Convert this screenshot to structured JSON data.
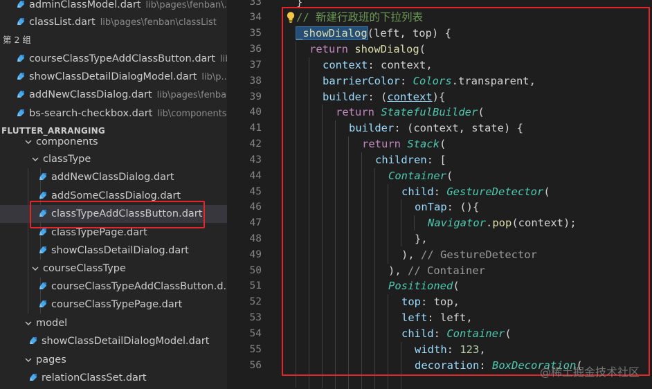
{
  "sidebar": {
    "top_items": [
      {
        "name": "adminClassModel.dart",
        "path": "lib\\pages\\fenban\\..."
      },
      {
        "name": "classList.dart",
        "path": "lib\\pages\\fenban\\classList"
      }
    ],
    "group_label": "第 2 组",
    "group_items": [
      {
        "name": "courseClassTypeAddClassButton.dart",
        "path": "lib..."
      },
      {
        "name": "showClassDetailDialogModel.dart",
        "path": "lib\\p..."
      },
      {
        "name": "addNewClassDialog.dart",
        "path": "lib\\pages\\fenba..."
      },
      {
        "name": "bs-search-checkbox.dart",
        "path": "lib\\components"
      }
    ],
    "project_title": "FLUTTER_ARRANGING",
    "tree": {
      "components": "components",
      "classType": "classType",
      "classType_files": [
        "addNewClassDialog.dart",
        "addSomeClassDialog.dart",
        "classTypeAddClassButton.dart",
        "classTypePage.dart",
        "showClassDetailDialog.dart"
      ],
      "courseClassType": "courseClassType",
      "courseClassType_files": [
        "courseClassTypeAddClassButton.d...",
        "courseClassTypePage.dart"
      ],
      "model": "model",
      "model_files": [
        "showClassDetailDialogModel.dart"
      ],
      "pages": "pages",
      "pages_files": [
        "relationClassSet.dart"
      ]
    }
  },
  "editor": {
    "line_numbers": [
      "33",
      "34",
      "35",
      "36",
      "37",
      "38",
      "39",
      "40",
      "41",
      "42",
      "43",
      "44",
      "45",
      "46",
      "47",
      "48",
      "49",
      "50",
      "51",
      "52",
      "53",
      "54",
      "55",
      "56"
    ],
    "code": {
      "l33": "}",
      "l34": "// 新建行政班的下拉列表",
      "l35_fn": "_showDialog",
      "l35_rest": "(left, top) {",
      "l36_kw": "return",
      "l36_fn": "showDialog",
      "l36_rest": "(",
      "l37_p": "context",
      "l37_rest": ": context,",
      "l38_p": "barrierColor",
      "l38_colon": ": ",
      "l38_t": "Colors",
      "l38_rest": ".transparent,",
      "l39_p": "builder",
      "l39_colon": ": (",
      "l39_ctx": "context",
      "l39_rest": "){",
      "l40_kw": "return",
      "l40_t": "StatefulBuilder",
      "l40_rest": "(",
      "l41_p": "builder",
      "l41_rest": ": (context, state) {",
      "l42_kw": "return",
      "l42_t": "Stack",
      "l42_rest": "(",
      "l43_p": "children",
      "l43_rest": ": [",
      "l44_t": "Container",
      "l44_rest": "(",
      "l45_p": "child",
      "l45_colon": ": ",
      "l45_t": "GestureDetector",
      "l45_rest": "(",
      "l46_p": "onTap",
      "l46_rest": ": (){",
      "l47_t": "Navigator",
      "l47_dot": ".",
      "l47_fn": "pop",
      "l47_rest": "(context);",
      "l48": "},",
      "l49_a": "), ",
      "l49_c": "// GestureDetector",
      "l50_a": "), ",
      "l50_c": "// Container",
      "l51_t": "Positioned",
      "l51_rest": "(",
      "l52_p": "top",
      "l52_rest": ": top,",
      "l53_p": "left",
      "l53_rest": ": left,",
      "l54_p": "child",
      "l54_colon": ": ",
      "l54_t": "Container",
      "l54_rest": "(",
      "l55_p": "width",
      "l55_colon": ": ",
      "l55_n": "123",
      "l55_rest": ",",
      "l56_p": "decoration",
      "l56_colon": ": ",
      "l56_t": "BoxDecoration",
      "l56_rest": "("
    }
  },
  "watermark": "@稀土掘金技术社区",
  "colors": {
    "highlight_box": "#e3262a",
    "sidebar_bg": "#252526",
    "editor_bg": "#1e1e1e",
    "dart_icon": "#3d9be9"
  }
}
